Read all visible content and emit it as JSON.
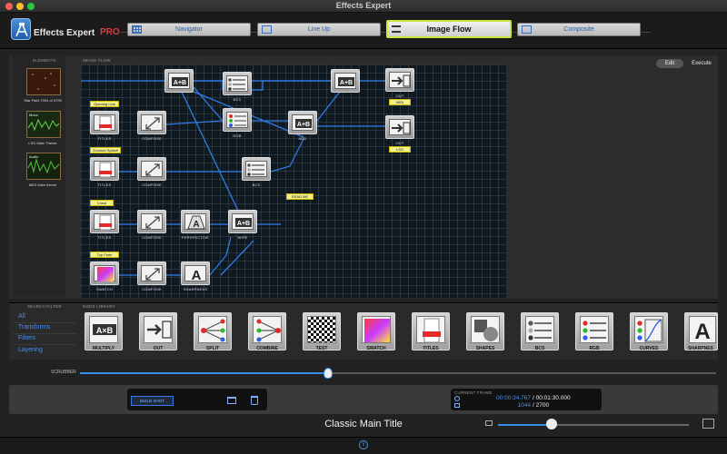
{
  "window": {
    "title": "Effects Expert"
  },
  "app": {
    "name": "Effects Expert",
    "edition": "PRO"
  },
  "tabs": [
    {
      "label": "Navigator",
      "icon": "grid-icon"
    },
    {
      "label": "Line Up",
      "icon": "lineup-icon"
    },
    {
      "label": "Image Flow",
      "icon": "flow-icon",
      "active": true
    },
    {
      "label": "Composite",
      "icon": "play-icon"
    }
  ],
  "mode": {
    "edit": "Edit",
    "execute": "Execute"
  },
  "elements": {
    "heading": "ELEMENTS",
    "items": [
      {
        "label": "Star Field 7004 of 3795",
        "overlay": ""
      },
      {
        "label": "LSG Main Theme",
        "overlay": "Moov"
      },
      {
        "label": "MIDI Main theme",
        "overlay": "Audio"
      }
    ]
  },
  "graph": {
    "heading": "IMAGE FLOW",
    "nodes": [
      {
        "label": "",
        "glyph": "A+B"
      },
      {
        "label": "BCS",
        "glyph": "sliders"
      },
      {
        "label": "",
        "glyph": "A+B"
      },
      {
        "label": "OUT",
        "glyph": "arrow"
      },
      {
        "label": "TITLES",
        "glyph": "titles"
      },
      {
        "label": "COMPOSE",
        "glyph": "compose"
      },
      {
        "label": "RGB",
        "glyph": "rgb"
      },
      {
        "label": "ADD",
        "glyph": "A+B"
      },
      {
        "label": "OUT",
        "glyph": "arrow"
      },
      {
        "label": "TITLES",
        "glyph": "titles"
      },
      {
        "label": "COMPOSE",
        "glyph": "compose"
      },
      {
        "label": "BCS",
        "glyph": "sliders"
      },
      {
        "label": "TITLES",
        "glyph": "titles"
      },
      {
        "label": "COMPOSE",
        "glyph": "compose"
      },
      {
        "label": "PERSPECTIVE",
        "glyph": "perspective"
      },
      {
        "label": "WIPE",
        "glyph": "A+B"
      },
      {
        "label": "SWATCH",
        "glyph": "swatch"
      },
      {
        "label": "COMPOSE",
        "glyph": "compose"
      },
      {
        "label": "SHARPNESS",
        "glyph": "sharp"
      }
    ],
    "tags": {
      "opening": "Opening Line",
      "zoomed": "Zoomed Splash",
      "crawl": "Crawl",
      "top_fade": "Top Fade",
      "midi": "MIDI",
      "lsg": "LSG",
      "readme": "READ ME"
    }
  },
  "search_filter": {
    "heading": "SEARCH FILTER",
    "items": [
      "All",
      "Transforms",
      "Filters",
      "Layering"
    ]
  },
  "node_library": {
    "heading": "NODE LIBRARY",
    "items": [
      "MULTIPLY",
      "OUT",
      "SPLIT",
      "COMBINE",
      "TEST",
      "SWATCH",
      "TITLES",
      "SHAPES",
      "BCS",
      "RGB",
      "CURVES",
      "SHARPNES"
    ]
  },
  "scrubber": {
    "label": "SCRUBBER",
    "position": 0.39
  },
  "compositor": {
    "heading": "COMPOSITOR",
    "build_label": "BUILD SHOT"
  },
  "current_frame": {
    "heading": "CURRENT FRAME",
    "time": "00:00:34.767",
    "total_time": "/ 00:01:30.000",
    "frame": "1044",
    "total_frames": "/ 2700"
  },
  "composition_title": "Classic Main Title",
  "zoom": {
    "value": 0.28
  },
  "colors": {
    "accent": "#3a8fe8",
    "active_tab_border": "#c8e83a",
    "pro": "#e23b3b"
  }
}
